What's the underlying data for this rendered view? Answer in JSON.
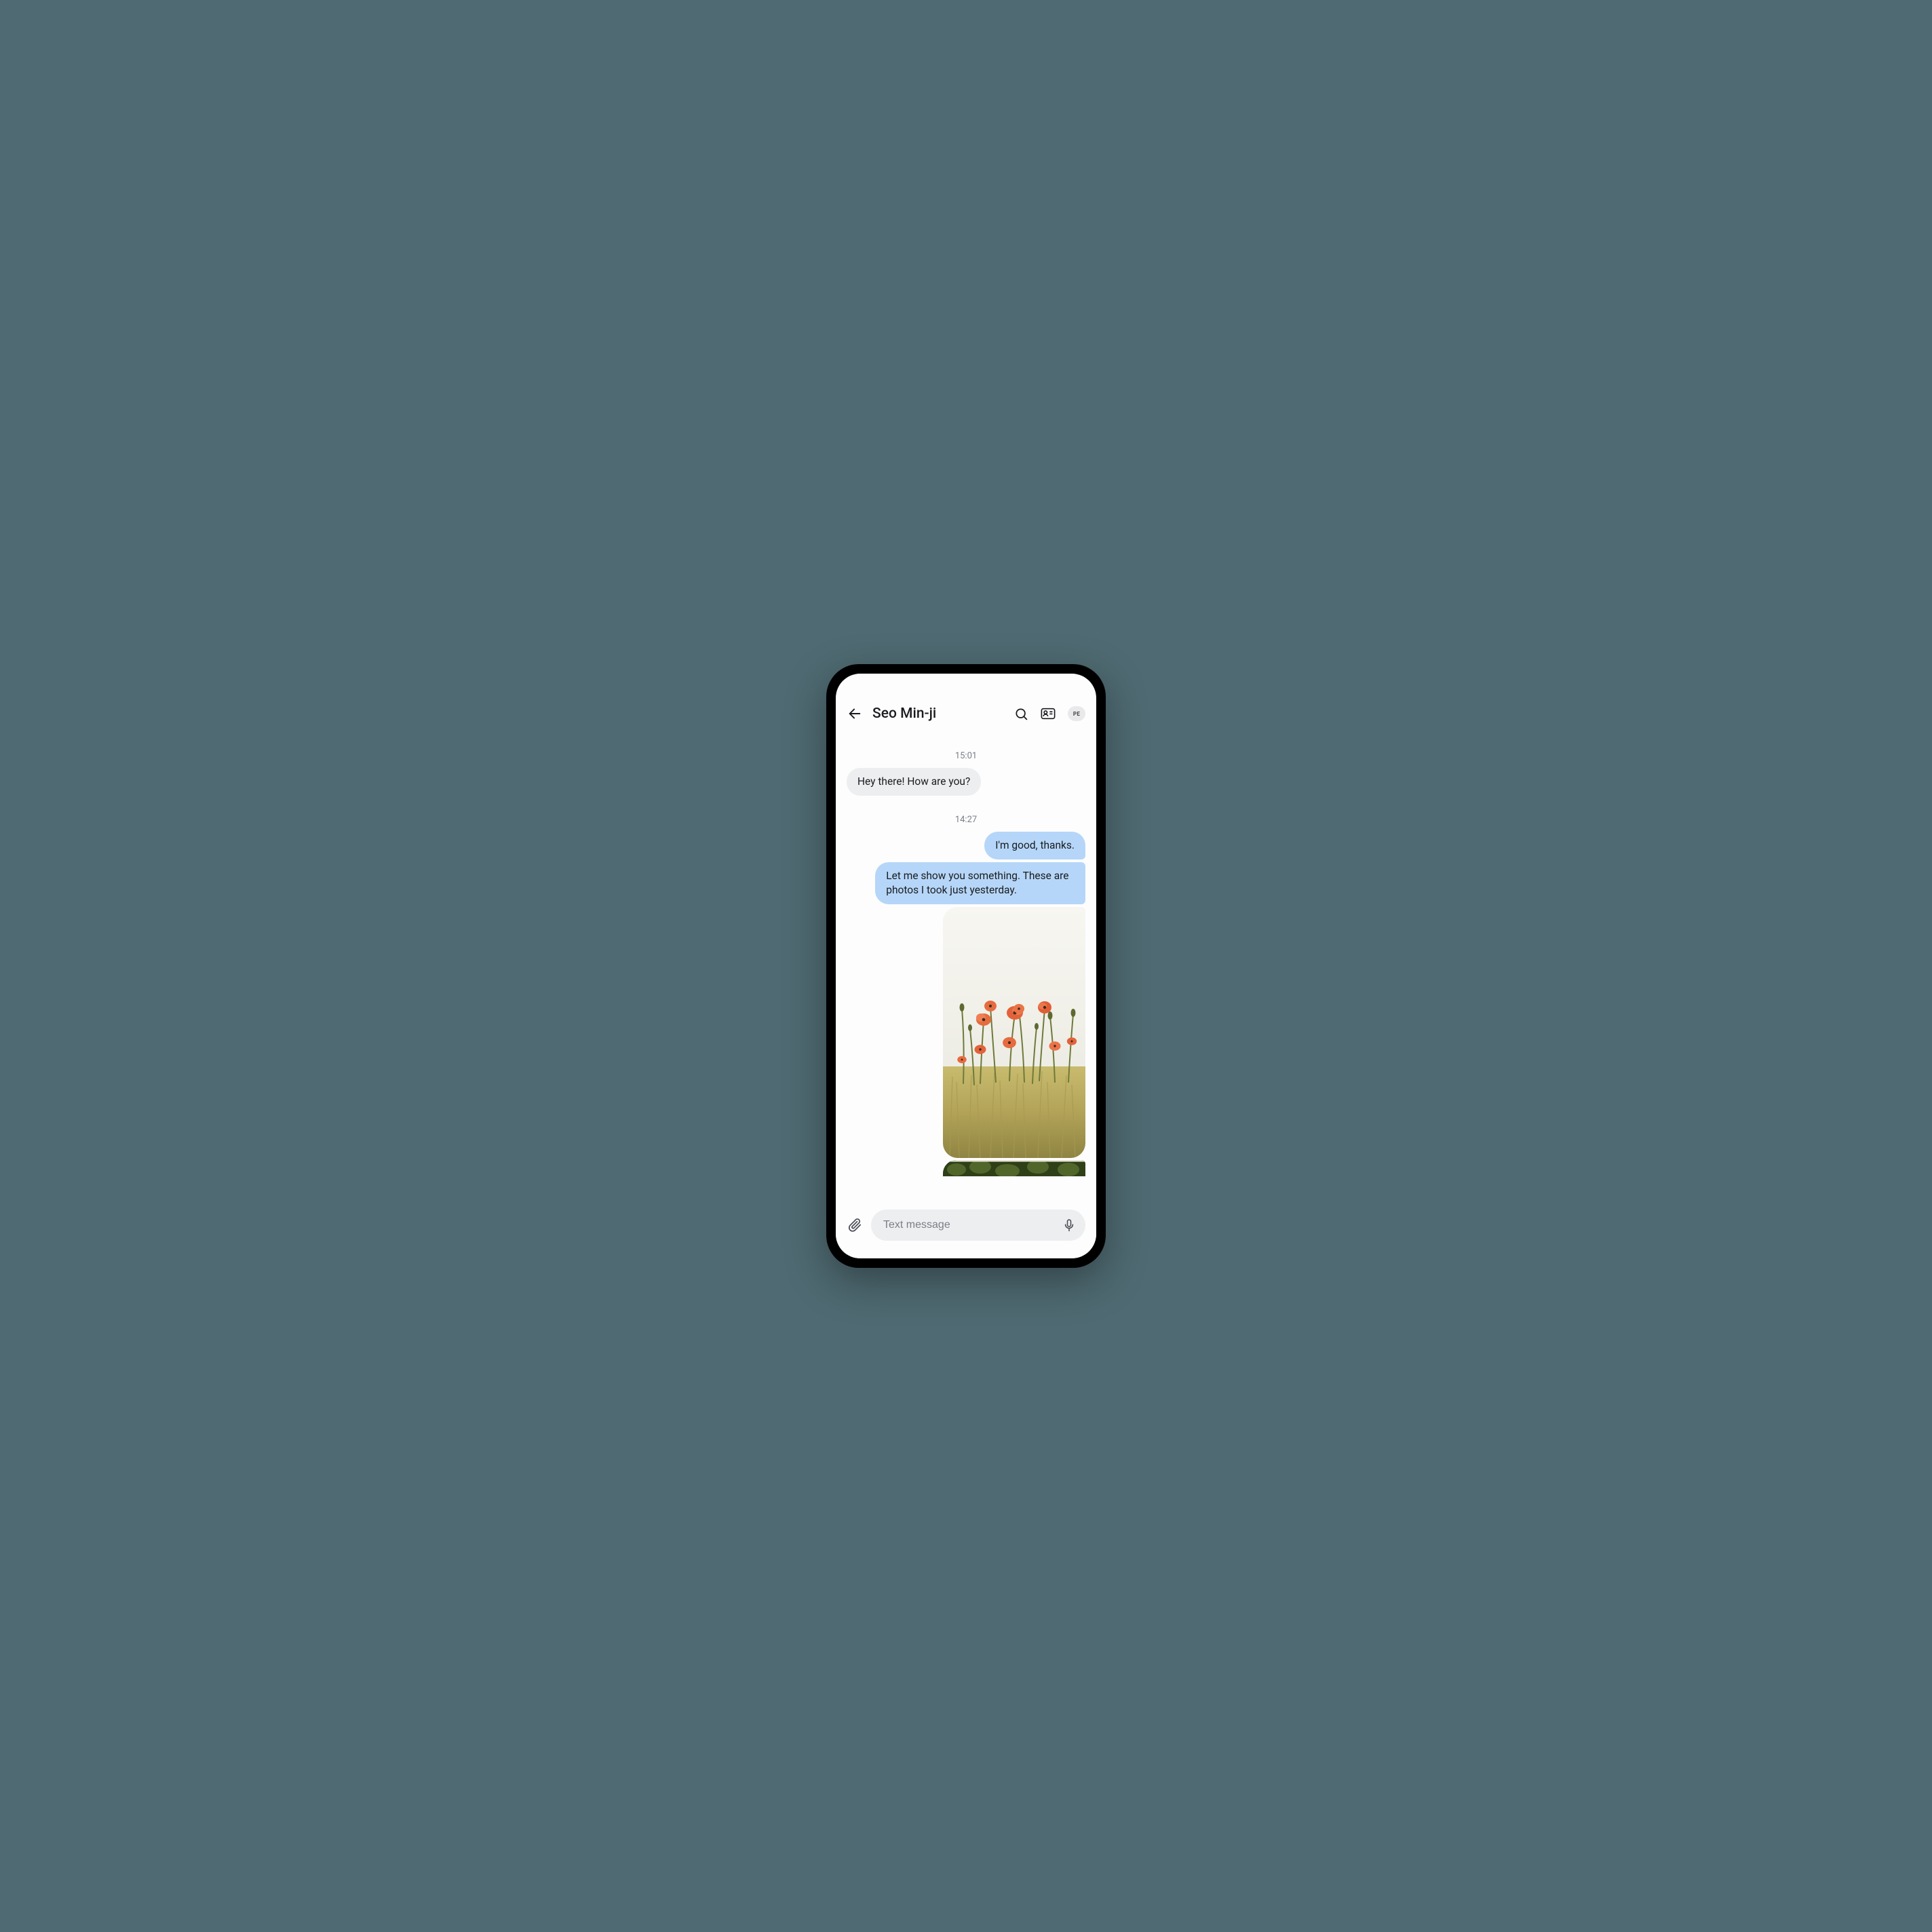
{
  "header": {
    "contact_name": "Seo Min-ji",
    "avatar_initials": "PE"
  },
  "conversation": {
    "groups": [
      {
        "time": "15:01",
        "messages": [
          {
            "dir": "in",
            "text": "Hey there! How are you?"
          }
        ]
      },
      {
        "time": "14:27",
        "messages": [
          {
            "dir": "out",
            "text": "I'm good, thanks."
          },
          {
            "dir": "out",
            "text": "Let me show you something. These are photos I took just yesterday."
          },
          {
            "dir": "out",
            "kind": "photo",
            "alt": "Field of orange poppies in tall golden grass under a pale sky"
          },
          {
            "dir": "out",
            "kind": "photo-partial",
            "alt": "Top edge of a second green foliage photo"
          }
        ]
      }
    ]
  },
  "input": {
    "placeholder": "Text message"
  },
  "colors": {
    "page_bg": "#4f6a72",
    "incoming_bubble": "#edeef0",
    "outgoing_bubble": "#b5d6f8"
  }
}
